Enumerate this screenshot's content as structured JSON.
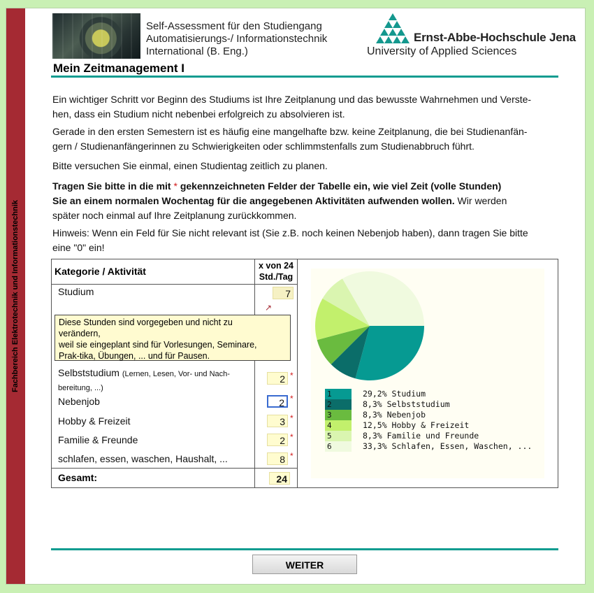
{
  "sidebar_text": "Fachbereich Elektrotechnik und Informationstechnik",
  "header": {
    "line1": "Self-Assessment für den Studiengang",
    "line2": "Automatisierungs-/ Informationstechnik",
    "line3": "International (B. Eng.)",
    "school_name": "Ernst-Abbe-Hochschule Jena",
    "school_sub": "University of Applied Sciences"
  },
  "page_title": "Mein Zeitmanagement I",
  "intro": {
    "p1a": "Ein wichtiger Schritt vor Beginn des Studiums ist Ihre Zeitplanung und das bewusste Wahrnehmen und Verste-",
    "p1b": "hen, dass ein Studium nicht nebenbei erfolgreich zu absolvieren ist.",
    "p2a": "Gerade in den ersten Semestern ist es häufig eine mangelhafte bzw. keine Zeitplanung, die bei Studienanfän-",
    "p2b": "gern / Studienanfängerinnen zu Schwierigkeiten oder schlimmstenfalls zum Studienabbruch führt.",
    "p3": "Bitte versuchen Sie einmal, einen Studientag zeitlich zu planen.",
    "p4_bold_a1": "Tragen Sie bitte in die mit ",
    "p4_star": "*",
    "p4_bold_a2": " gekennzeichneten Felder der Tabelle ein, wie viel Zeit (volle Stunden)",
    "p4_bold_b": "Sie an einem normalen Wochentag für die angegebenen Aktivitäten aufwenden wollen.",
    "p4_normal_b": " Wir werden",
    "p4_c": "später noch einmal auf Ihre Zeitplanung zurückkommen.",
    "p5a": "Hinweis: Wenn ein Feld für Sie nicht relevant ist (Sie z.B. noch keinen Nebenjob haben), dann tragen Sie bitte",
    "p5b": "eine \"0\" ein!"
  },
  "table": {
    "col1_header": "Kategorie / Aktivität",
    "col2_header_a": "x von 24",
    "col2_header_b": "Std./Tag",
    "rows": [
      {
        "label": "Studium",
        "value": "7"
      },
      {
        "label": "Selbststudium",
        "sublabel_a": "(Lernen, Lesen, Vor- und Nach-",
        "sublabel_b": "bereitung, ...)",
        "value": "2",
        "star": "*"
      },
      {
        "label": "Nebenjob",
        "value": "2",
        "star": "*"
      },
      {
        "label": "Hobby & Freizeit",
        "value": "3",
        "star": "*"
      },
      {
        "label": "Familie & Freunde",
        "value": "2",
        "star": "*"
      },
      {
        "label": "schlafen, essen, waschen, Haushalt, ...",
        "value": "8",
        "star": "*"
      }
    ],
    "total_label": "Gesamt:",
    "total_value": "24",
    "arrow_glyph": "↗",
    "tooltip": {
      "l1": "Diese Stunden sind vorgegeben und nicht zu",
      "l2": "verändern,",
      "l3": "weil sie eingeplant sind für Vorlesungen, Seminare,",
      "l4": "Prak-tika, Übungen, ... und für Pausen."
    }
  },
  "chart_data": {
    "type": "pie",
    "categories": [
      "Studium",
      "Selbststudium",
      "Nebenjob",
      "Hobby & Freizeit",
      "Familie und Freunde",
      "Schlafen, Essen, Waschen, ..."
    ],
    "values": [
      29.2,
      8.3,
      8.3,
      12.5,
      8.3,
      33.3
    ],
    "colors": [
      "#069a92",
      "#0b6d69",
      "#6abb3f",
      "#c2f06c",
      "#daf5b0",
      "#f0fadf"
    ],
    "legend": [
      {
        "num": "1",
        "label": "29,2% Studium"
      },
      {
        "num": "2",
        "label": "8,3% Selbststudium"
      },
      {
        "num": "3",
        "label": "8,3% Nebenjob"
      },
      {
        "num": "4",
        "label": "12,5% Hobby & Freizeit"
      },
      {
        "num": "5",
        "label": "8,3% Familie und Freunde"
      },
      {
        "num": "6",
        "label": "33,3% Schlafen, Essen, Waschen, ..."
      }
    ]
  },
  "weiter_label": "WEITER"
}
